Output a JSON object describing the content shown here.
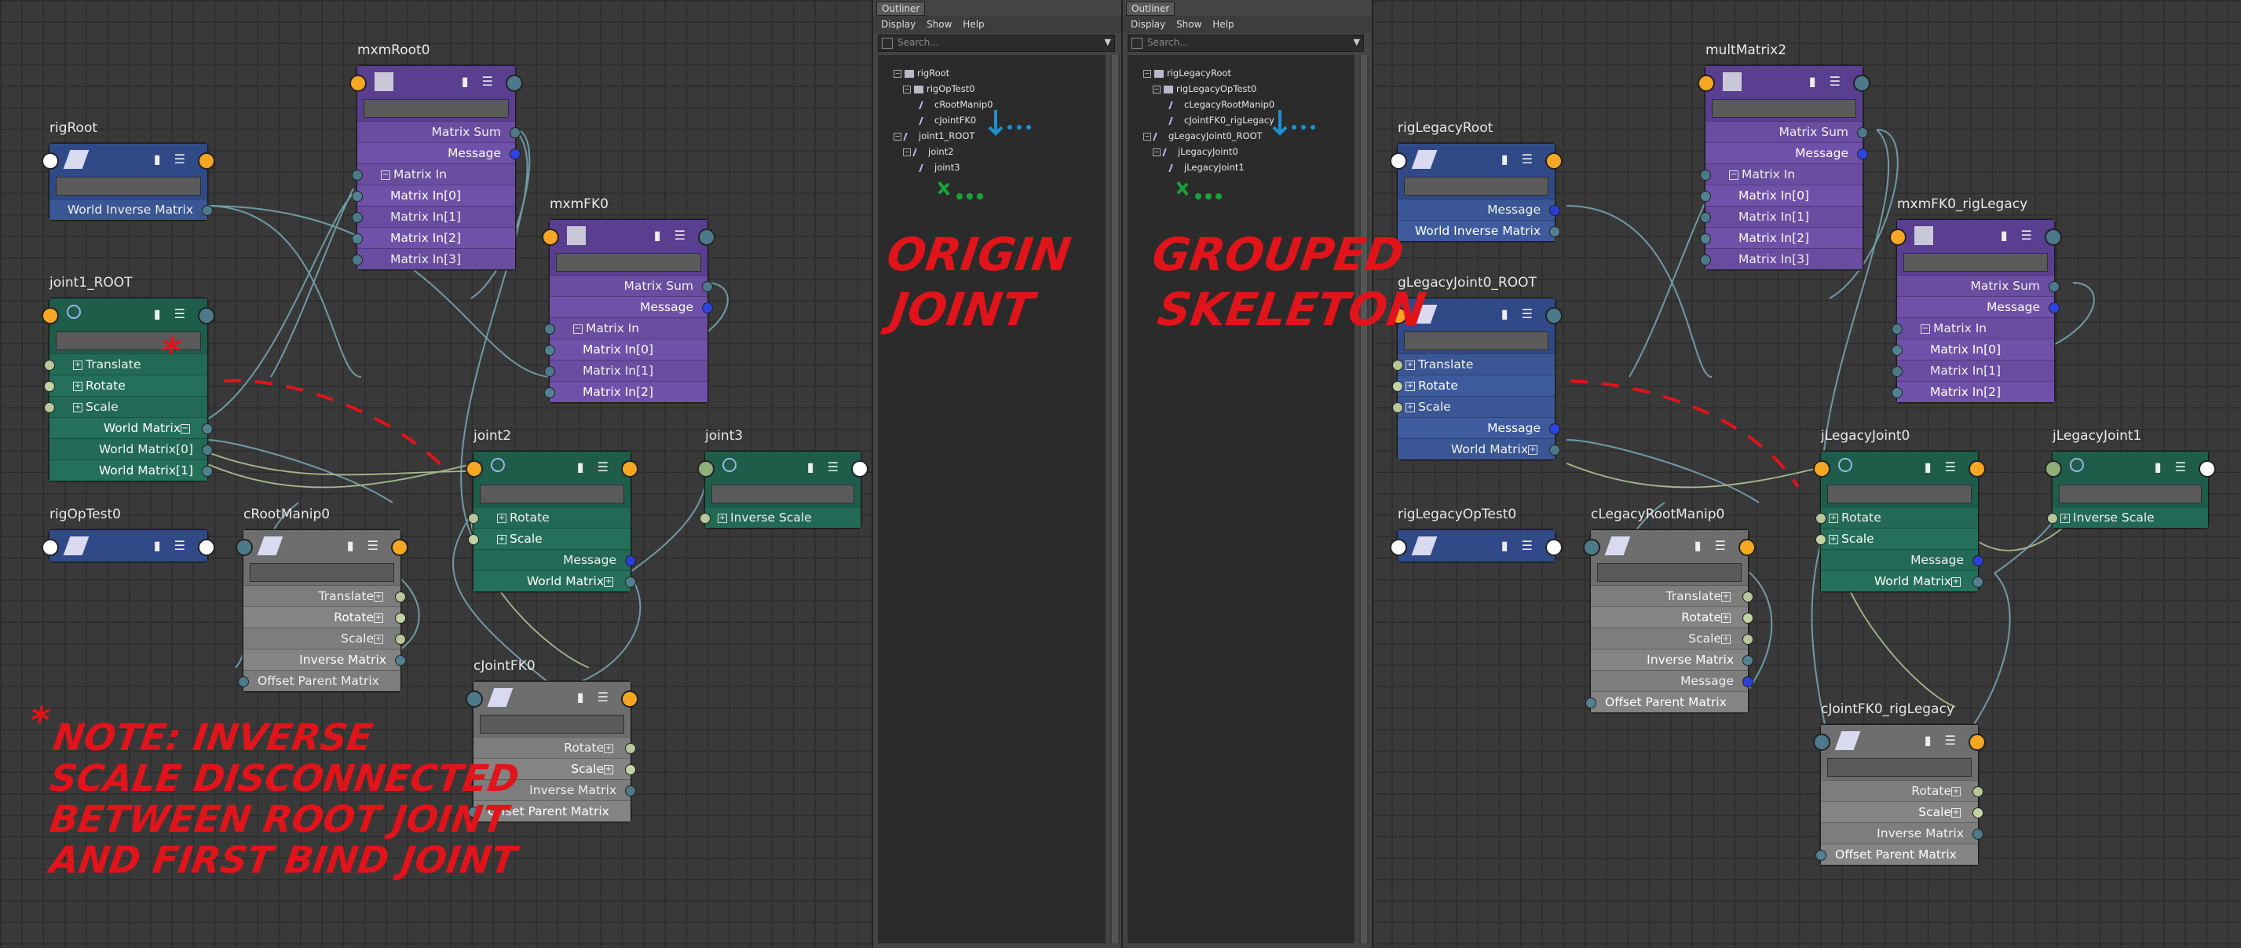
{
  "outliners": [
    {
      "tab": "Outliner",
      "menu": [
        "Display",
        "Show",
        "Help"
      ],
      "search_placeholder": "Search...",
      "items": [
        "rigRoot",
        "rigOpTest0",
        "cRootManip0",
        "cJointFK0",
        "joint1_ROOT",
        "joint2",
        "joint3"
      ]
    },
    {
      "tab": "Outliner",
      "menu": [
        "Display",
        "Show",
        "Help"
      ],
      "search_placeholder": "Search...",
      "items": [
        "rigLegacyRoot",
        "rigLegacyOpTest0",
        "cLegacyRootManip0",
        "cJointFK0_rigLegacy",
        "gLegacyJoint0_ROOT",
        "jLegacyJoint0",
        "jLegacyJoint1"
      ]
    }
  ],
  "annotations": {
    "origin_joint": [
      "ORIGIN",
      "JOINT"
    ],
    "grouped_skeleton": [
      "GROUPED",
      "SKELETON"
    ],
    "note": [
      "NOTE: INVERSE",
      "SCALE DISCONNECTED",
      "BETWEEN ROOT JOINT",
      "AND FIRST BIND JOINT"
    ],
    "asterisk": "*"
  },
  "left_nodes": {
    "rigRoot": {
      "title": "rigRoot",
      "rows": [
        "World Inverse Matrix"
      ]
    },
    "mxmRoot0": {
      "title": "mxmRoot0",
      "rows": [
        "Matrix Sum",
        "Message",
        "Matrix In",
        "Matrix In[0]",
        "Matrix In[1]",
        "Matrix In[2]",
        "Matrix In[3]"
      ]
    },
    "mxmFK0": {
      "title": "mxmFK0",
      "rows": [
        "Matrix Sum",
        "Message",
        "Matrix In",
        "Matrix In[0]",
        "Matrix In[1]",
        "Matrix In[2]"
      ]
    },
    "joint1_ROOT": {
      "title": "joint1_ROOT",
      "rows": [
        "Translate",
        "Rotate",
        "Scale",
        "World Matrix",
        "World Matrix[0]",
        "World Matrix[1]"
      ]
    },
    "joint2": {
      "title": "joint2",
      "rows": [
        "Rotate",
        "Scale",
        "Message",
        "World Matrix"
      ]
    },
    "joint3": {
      "title": "joint3",
      "rows": [
        "Inverse Scale"
      ]
    },
    "rigOpTest0": {
      "title": "rigOpTest0",
      "rows": []
    },
    "cRootManip0": {
      "title": "cRootManip0",
      "rows": [
        "Translate",
        "Rotate",
        "Scale",
        "Inverse Matrix",
        "Offset Parent Matrix"
      ]
    },
    "cJointFK0": {
      "title": "cJointFK0",
      "rows": [
        "Rotate",
        "Scale",
        "Inverse Matrix",
        "Offset Parent Matrix"
      ]
    }
  },
  "right_nodes": {
    "rigLegacyRoot": {
      "title": "rigLegacyRoot",
      "rows": [
        "Message",
        "World Inverse Matrix"
      ]
    },
    "multMatrix2": {
      "title": "multMatrix2",
      "rows": [
        "Matrix Sum",
        "Message",
        "Matrix In",
        "Matrix In[0]",
        "Matrix In[1]",
        "Matrix In[2]",
        "Matrix In[3]"
      ]
    },
    "mxmFK0_rigLegacy": {
      "title": "mxmFK0_rigLegacy",
      "rows": [
        "Matrix Sum",
        "Message",
        "Matrix In",
        "Matrix In[0]",
        "Matrix In[1]",
        "Matrix In[2]"
      ]
    },
    "gLegacyJoint0_ROOT": {
      "title": "gLegacyJoint0_ROOT",
      "rows": [
        "Translate",
        "Rotate",
        "Scale",
        "Message",
        "World Matrix"
      ]
    },
    "jLegacyJoint0": {
      "title": "jLegacyJoint0",
      "rows": [
        "Rotate",
        "Scale",
        "Message",
        "World Matrix"
      ]
    },
    "jLegacyJoint1": {
      "title": "jLegacyJoint1",
      "rows": [
        "Inverse Scale"
      ]
    },
    "rigLegacyOpTest0": {
      "title": "rigLegacyOpTest0",
      "rows": []
    },
    "cLegacyRootManip0": {
      "title": "cLegacyRootManip0",
      "rows": [
        "Translate",
        "Rotate",
        "Scale",
        "Inverse Matrix",
        "Message",
        "Offset Parent Matrix"
      ]
    },
    "cJointFK0_rigLegacy": {
      "title": "cJointFK0_rigLegacy",
      "rows": [
        "Rotate",
        "Scale",
        "Inverse Matrix",
        "Offset Parent Matrix"
      ]
    }
  }
}
